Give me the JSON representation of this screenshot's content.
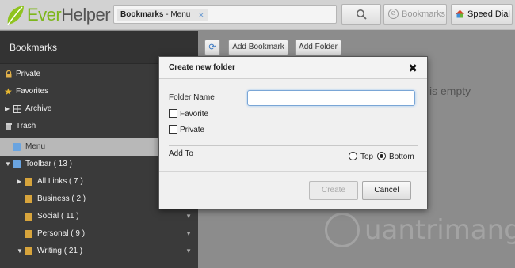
{
  "header": {
    "logo_text": "EverHelper",
    "breadcrumb_bold": "Bookmarks",
    "breadcrumb_rest": " - Menu",
    "breadcrumb_close": "×",
    "search_icon": "search-icon",
    "bookmarks_label": "Bookmarks",
    "speed_dial_label": "Speed Dial"
  },
  "sidebar": {
    "title": "Bookmarks",
    "items": [
      {
        "label": "Private",
        "icon": "lock-icon"
      },
      {
        "label": "Favorites",
        "icon": "star-icon"
      },
      {
        "label": "Archive",
        "icon": "archive-icon"
      },
      {
        "label": "Trash",
        "icon": "trash-icon"
      },
      {
        "label": "Menu",
        "icon": "folder-icon"
      },
      {
        "label": "Toolbar ( 13 )",
        "icon": "folder-icon"
      },
      {
        "label": "All Links ( 7 )",
        "icon": "folder-icon"
      },
      {
        "label": "Business ( 2 )",
        "icon": "folder-icon"
      },
      {
        "label": "Social ( 11 )",
        "icon": "folder-icon"
      },
      {
        "label": "Personal ( 9 )",
        "icon": "folder-icon"
      },
      {
        "label": "Writing ( 21 )",
        "icon": "folder-icon"
      }
    ]
  },
  "main": {
    "add_bookmark_label": "Add Bookmark",
    "add_folder_label": "Add Folder",
    "empty_text": "is empty",
    "watermark_text": "uantrimang"
  },
  "dialog": {
    "title": "Create new folder",
    "close_symbol": "✖",
    "folder_name_label": "Folder Name",
    "folder_name_value": "",
    "favorite_label": "Favorite",
    "private_label": "Private",
    "add_to_label": "Add To",
    "top_label": "Top",
    "bottom_label": "Bottom",
    "selected_position": "Bottom",
    "create_label": "Create",
    "cancel_label": "Cancel"
  },
  "colors": {
    "overlay_gray": "#8c8c8c",
    "sidebar_dark": "#3a3a3a",
    "logo_green": "#7db61c",
    "folder_yellow": "#d7a43c",
    "folder_blue": "#6aa4e0",
    "input_focus_blue": "#7aa6d6"
  }
}
